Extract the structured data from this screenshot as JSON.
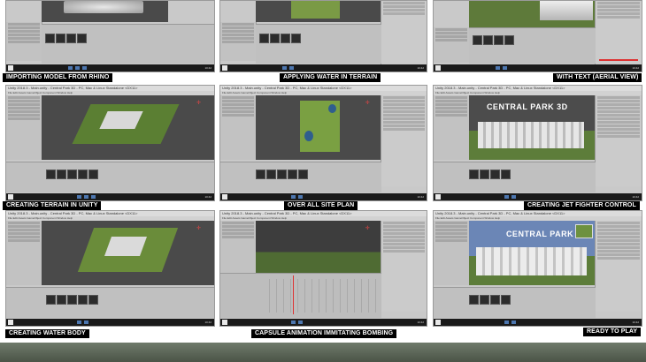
{
  "window": {
    "title_text": "Unity 2018.3 - Main.unity - Central Park 3D - PC, Mac & Linux Standalone <DX11>",
    "menu_text": "File  Edit  Assets  GameObject  Component  Window  Help",
    "clock": "10:42"
  },
  "panels": [
    {
      "caption": "IMPORTING MODEL FROM RHINO",
      "scene": "city-model"
    },
    {
      "caption": "APPLYING WATER IN TERRAIN",
      "scene": "terrain-water"
    },
    {
      "caption": "WITH TEXT (AERIAL VIEW)",
      "scene": "aerial-text"
    },
    {
      "caption": "CREATING TERRAIN IN UNITY",
      "scene": "terrain"
    },
    {
      "caption": "OVER ALL SITE PLAN",
      "scene": "site-plan"
    },
    {
      "caption": "CREATING JET FIGHTER  CONTROL",
      "scene": "jet-fighter",
      "game_text": "CENTRAL PARK 3D"
    },
    {
      "caption": "CREATING WATER BODY",
      "scene": "water-body"
    },
    {
      "caption": "CAPSULE ANIMATION IMMITATING BOMBING",
      "scene": "capsule-animation"
    },
    {
      "caption": "READY TO PLAY",
      "scene": "ready-to-play",
      "game_text": "CENTRAL PARK 3D"
    }
  ],
  "colors": {
    "unity_scene": "#4a4a4a",
    "terrain_green": "#5b7f33",
    "caption_bg": "#000000",
    "caption_text": "#ffffff"
  }
}
